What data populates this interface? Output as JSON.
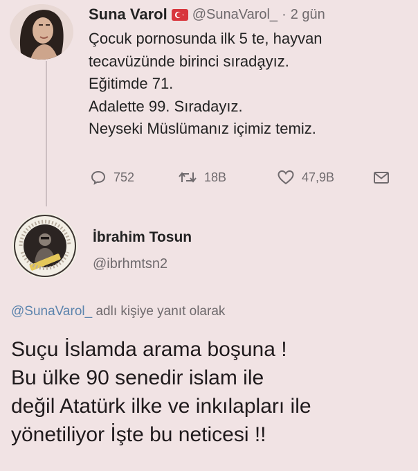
{
  "tweet": {
    "display_name": "Suna Varol",
    "handle": "@SunaVarol_",
    "separator": "·",
    "time": "2 gün",
    "lines": [
      "Çocuk pornosunda ilk 5 te, hayvan",
      "tecavüzünde birinci sırada̧yız.",
      "Eğitimde 71.",
      "Adalette 99. Sıradayız.",
      "Neyseki Müslümanız içimiz temiz."
    ],
    "actions": {
      "replies": "752",
      "retweets": "18B",
      "likes": "47,9B"
    }
  },
  "reply": {
    "display_name": "İbrahim Tosun",
    "handle": "@ibrhmtsn2",
    "reply_mention": "@SunaVarol_",
    "reply_suffix": " adlı kişiye yanıt olarak",
    "lines": [
      "Suçu İslamda arama boşuna !",
      "Bu ülke 90 senedir islam ile",
      "değil Atatürk ilke ve inkılapları ile",
      "yönetiliyor İşte bu neticesi !!"
    ]
  },
  "colors": {
    "background": "#f1e3e4",
    "text": "#222222",
    "secondary": "#6f6a6d",
    "mention": "#5c84ad",
    "flag_red": "#d8363d"
  },
  "icons": {
    "reply": "reply-icon",
    "retweet": "retweet-icon",
    "like": "heart-icon",
    "share": "share-icon",
    "flag": "turkey-flag-icon"
  }
}
